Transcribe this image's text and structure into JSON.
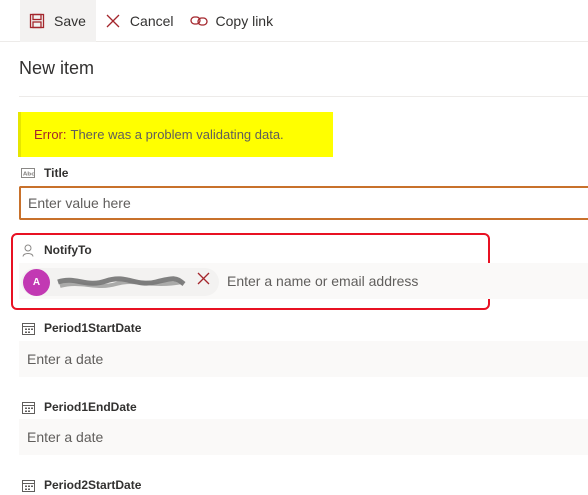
{
  "toolbar": {
    "save_label": "Save",
    "cancel_label": "Cancel",
    "copy_link_label": "Copy link"
  },
  "page": {
    "title": "New item"
  },
  "error": {
    "label": "Error:",
    "message": "There was a problem validating data."
  },
  "fields": {
    "title": {
      "label": "Title",
      "placeholder": "Enter value here"
    },
    "notify_to": {
      "label": "NotifyTo",
      "persona_initial": "A",
      "placeholder": "Enter a name or email address"
    },
    "period1_start": {
      "label": "Period1StartDate",
      "placeholder": "Enter a date"
    },
    "period1_end": {
      "label": "Period1EndDate",
      "placeholder": "Enter a date"
    },
    "period2_start": {
      "label": "Period2StartDate"
    }
  },
  "colors": {
    "accent": "#a4262c",
    "error_highlight": "#ffff00",
    "annotation_border": "#e81123",
    "avatar": "#c239b3",
    "input_focus_border": "#c8712b"
  }
}
